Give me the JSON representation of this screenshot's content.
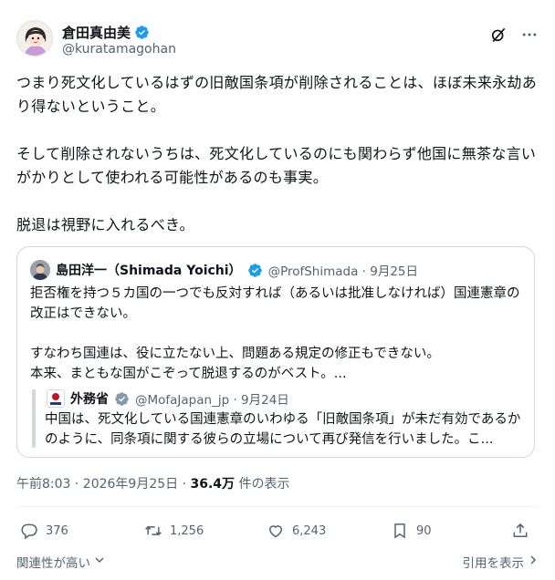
{
  "author": {
    "display_name": "倉田真由美",
    "handle": "@kuratamagohan"
  },
  "tweet_text": "つまり死文化しているはずの旧敵国条項が削除されることは、ほぼ未来永劫あり得ないということ。\n\nそして削除されないうちは、死文化しているのにも関わらず他国に無茶な言いがかりとして使われる可能性があるのも事実。\n\n脱退は視野に入れるべき。",
  "quote": {
    "display_name": "島田洋一（Shimada Yoichi）",
    "handle_date": "@ProfShimada · 9月25日",
    "text": "拒否権を持つ５カ国の一つでも反対すれば（あるいは批准しなければ）国連憲章の改正はできない。\n\nすなわち国連は、役に立たない上、問題ある規定の修正もできない。\n本来、まともな国がこぞって脱退するのがベスト。...",
    "nested": {
      "display_name": "外務省",
      "handle_date": "@MofaJapan_jp · 9月24日",
      "text": "中国は、死文化している国連憲章のいわゆる「旧敵国条項」が未だ有効であるかのように、同条項に関する彼らの立場について再び発信を行いました。こ..."
    }
  },
  "timestamp": {
    "time_date": "午前8:03 · 2026年9月25日 · ",
    "views_count": "36.4万",
    "views_label": " 件の表示"
  },
  "actions": {
    "replies": "376",
    "retweets": "1,256",
    "likes": "6,243",
    "bookmarks": "90"
  },
  "footer": {
    "sort_label": "関連性が高い",
    "quotes_label": "引用を表示"
  },
  "colors": {
    "verified_blue": "#1d9bf0",
    "verified_gray": "#829aab",
    "text": "#0f1419",
    "secondary": "#536471"
  }
}
